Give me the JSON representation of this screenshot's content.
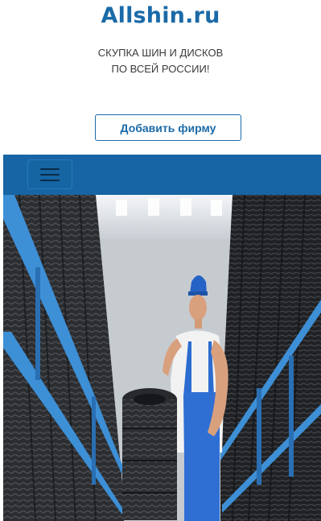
{
  "header": {
    "logo_text": "Allshin.ru",
    "tagline_line1": "СКУПКА ШИН И ДИСКОВ",
    "tagline_line2": "ПО ВСЕЙ РОССИИ!",
    "add_company_label": "Добавить фирму"
  },
  "navbar": {
    "menu_icon": "hamburger-icon"
  },
  "hero": {
    "image": "tire-warehouse-mechanic-photo"
  },
  "colors": {
    "brand": "#1b6aa8",
    "navbar": "#1765a4",
    "rack_blue": "#3d8fd6"
  }
}
